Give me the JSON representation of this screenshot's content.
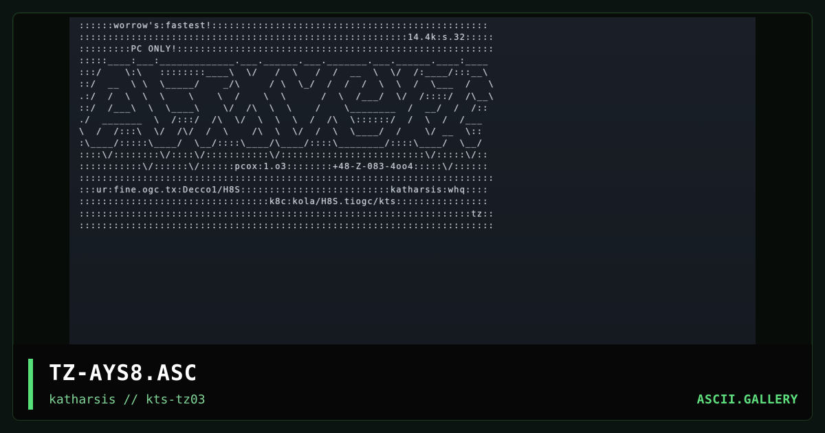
{
  "artwork": {
    "ascii_lines": [
      "::::::worrow's:fastest!::::::::::::::::::::::::::::::::::::::::::::::::",
      ":::::::::::::::::::::::::::::::::::::::::::::::::::::::::14.4k:s.32:::::",
      ":::::::::PC ONLY!:::::::::::::::::::::::::::::::::::::::::::::::::::::::",
      ":::::____:___:_____________.___.______.___._______.___.______.____:____",
      ":::/    \\:\\   ::::::::____\\  \\/   /  \\   /  /  __  \\  \\/  /:____/:::__\\",
      "::/  __  \\ \\  \\_____/    _/\\     / \\  \\_/  /  /  /  \\  \\  /  \\___  /   \\",
      ".:/  /  \\  \\  \\    \\    \\  /    \\  \\      /  \\  /___/  \\/  /::::/  /\\__\\",
      "::/  /___\\  \\  \\____\\    \\/  /\\  \\  \\    /    \\________  /  __/  /  /::",
      "./  _______  \\  /:::/  /\\  \\/  \\  \\  \\  /  /\\  \\::::::/  /  \\  /  /___",
      "\\  /  /:::\\  \\/  /\\/  /  \\    /\\  \\  \\/  /  \\  \\____/  /    \\/ __  \\::",
      ":\\____/:::::\\____/  \\__/::::\\____/\\____/::::\\________/::::\\____/  \\__/",
      "::::\\/::::::::\\/::::\\/:::::::::::\\/:::::::::::::::::::::::::\\/:::::\\/::",
      ":::::::::::\\/::::::\\/::::::pcox:1.o3::::::::+48-Z-083-4oo4:::::\\/::::::",
      "::::::::::::::::::::::::::::::::::::::::::::::::::::::::::::::::::::::::",
      ":::ur:fine.ogc.tx:Decco1/H8S::::::::::::::::::::::::::katharsis:whq::::",
      ":::::::::::::::::::::::::::::::::k8c:kola/H8S.tiogc/kts::::::::::::::::",
      "::::::::::::::::::::::::::::::::::::::::::::::::::::::::::::::::::::tz::",
      "::::::::::::::::::::::::::::::::::::::::::::::::::::::::::::::::::::::::"
    ]
  },
  "footer": {
    "title": "TZ-AYS8.ASC",
    "subtitle": "katharsis // kts-tz03",
    "brand": "ASCII.GALLERY"
  },
  "colors": {
    "accent": "#56e07a",
    "background": "#0b1410",
    "card_border": "#1f3a22"
  }
}
